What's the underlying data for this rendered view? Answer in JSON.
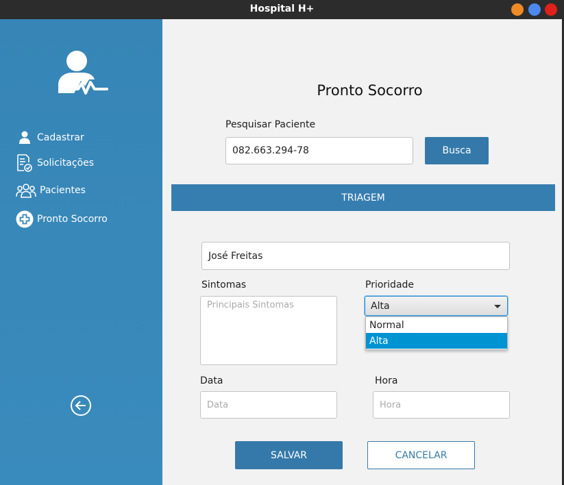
{
  "window": {
    "title": "Hospital H+"
  },
  "sidebar": {
    "items": [
      {
        "label": "Cadastrar",
        "icon": "user-icon"
      },
      {
        "label": "Solicitações",
        "icon": "clipboard-check-icon"
      },
      {
        "label": "Pacientes",
        "icon": "users-icon"
      },
      {
        "label": "Pronto Socorro",
        "icon": "plus-circle-icon"
      }
    ],
    "back_icon": "arrow-left-circle-icon",
    "logo_icon": "doctor-heartbeat-icon"
  },
  "main": {
    "title": "Pronto Socorro",
    "search": {
      "label": "Pesquisar Paciente",
      "value": "082.663.294-78",
      "button": "Busca"
    },
    "section_header": "TRIAGEM",
    "patient_name": "José Freitas",
    "symptoms": {
      "label": "Sintomas",
      "placeholder": "Principais Sintomas"
    },
    "priority": {
      "label": "Prioridade",
      "selected": "Alta",
      "options": [
        "Normal",
        "Alta"
      ]
    },
    "date": {
      "label": "Data",
      "placeholder": "Data"
    },
    "time": {
      "label": "Hora",
      "placeholder": "Hora"
    },
    "save_button": "SALVAR",
    "cancel_button": "CANCELAR"
  },
  "colors": {
    "sidebar": "#3685b6",
    "primary": "#3479a9",
    "selection": "#0093d2",
    "titlebar": "#2c2c2c"
  }
}
